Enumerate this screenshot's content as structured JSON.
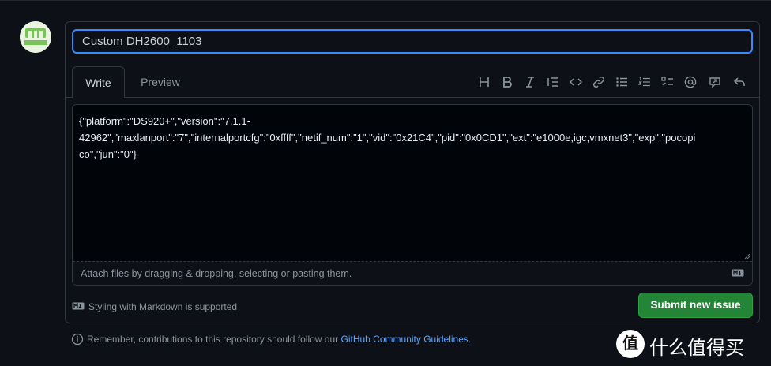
{
  "avatar": {
    "icon": "m-logo-avatar",
    "colors": {
      "fill": "#79c35a",
      "bg": "#e9f5e0"
    }
  },
  "issue": {
    "title_value": "Custom DH2600_1103",
    "tabs": {
      "write": "Write",
      "preview": "Preview"
    },
    "toolbar": [
      {
        "name": "heading-icon",
        "glyph": "H"
      },
      {
        "name": "bold-icon",
        "glyph": "B"
      },
      {
        "name": "italic-icon",
        "glyph": "I"
      },
      {
        "name": "quote-icon"
      },
      {
        "name": "code-icon"
      },
      {
        "name": "link-icon"
      },
      {
        "name": "bulleted-list-icon"
      },
      {
        "name": "numbered-list-icon"
      },
      {
        "name": "task-list-icon"
      },
      {
        "name": "mention-icon"
      },
      {
        "name": "reference-icon"
      },
      {
        "name": "reply-icon"
      }
    ],
    "body_value": "{\"platform\":\"DS920+\",\"version\":\"7.1.1-\n42962\",\"maxlanport\":\"7\",\"internalportcfg\":\"0xffff\",\"netif_num\":\"1\",\"vid\":\"0x21C4\",\"pid\":\"0x0CD1\",\"ext\":\"e1000e,igc,vmxnet3\",\"exp\":\"pocopi\nco\",\"jun\":\"0\"}",
    "attach_text": "Attach files by dragging & dropping, selecting or pasting them.",
    "markdown_note": "Styling with Markdown is supported",
    "submit_label": "Submit new issue"
  },
  "guidelines": {
    "prefix": "Remember, contributions to this repository should follow our ",
    "link": "GitHub Community Guidelines",
    "suffix": "."
  },
  "watermark": {
    "logo": "值",
    "text": "什么值得买"
  },
  "colors": {
    "accent": "#388bfd",
    "submit": "#238636",
    "link": "#58a6ff",
    "background": "#0d1117"
  }
}
